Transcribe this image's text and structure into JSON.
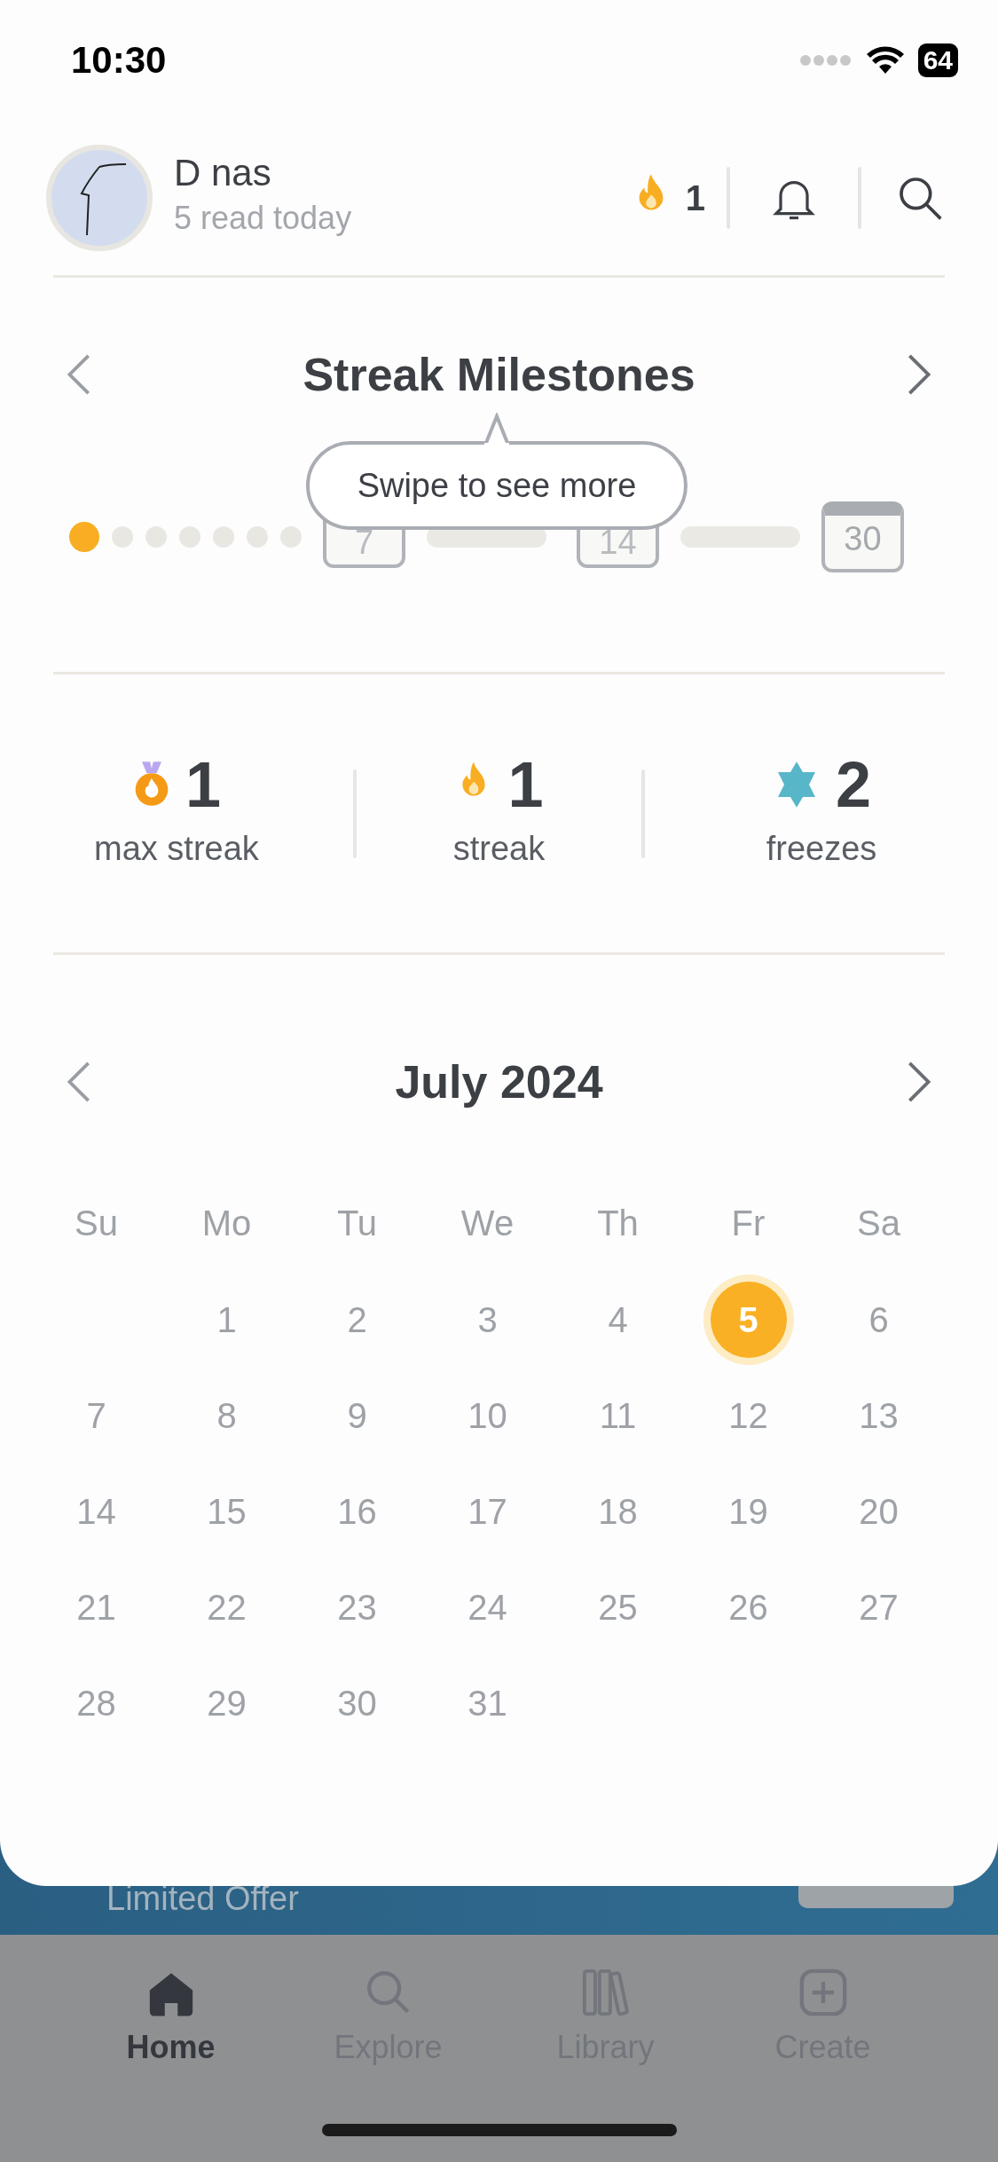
{
  "status_bar": {
    "time": "10:30",
    "battery": "64"
  },
  "header": {
    "name": "D nas",
    "subtitle": "5 read today",
    "streak": "1"
  },
  "milestones": {
    "title": "Streak Milestones",
    "tooltip": "Swipe to see more",
    "track": [
      {
        "kind": "dot",
        "filled": true
      },
      {
        "kind": "dot",
        "filled": false
      },
      {
        "kind": "dot",
        "filled": false
      },
      {
        "kind": "dot",
        "filled": false
      },
      {
        "kind": "dot",
        "filled": false
      },
      {
        "kind": "dot",
        "filled": false
      },
      {
        "kind": "dot",
        "filled": false
      },
      {
        "kind": "badge",
        "label": "7"
      },
      {
        "kind": "bar"
      },
      {
        "kind": "badge",
        "label": "14"
      },
      {
        "kind": "bar"
      },
      {
        "kind": "calendar",
        "label": "30"
      }
    ]
  },
  "stats": [
    {
      "kind": "medal",
      "value": "1",
      "label": "max streak"
    },
    {
      "kind": "flame",
      "value": "1",
      "label": "streak"
    },
    {
      "kind": "freeze",
      "value": "2",
      "label": "freezes"
    }
  ],
  "calendar": {
    "title": "July 2024",
    "weekdays": [
      "Su",
      "Mo",
      "Tu",
      "We",
      "Th",
      "Fr",
      "Sa"
    ],
    "weeks": [
      {
        "kind": "first",
        "days": [
          {
            "label": "1",
            "selected": false
          },
          {
            "label": "2",
            "selected": false
          },
          {
            "label": "3",
            "selected": false
          },
          {
            "label": "4",
            "selected": false
          },
          {
            "label": "5",
            "selected": true
          },
          {
            "label": "6",
            "selected": false
          }
        ]
      },
      {
        "kind": "rest",
        "days": [
          {
            "label": "7",
            "selected": false
          },
          {
            "label": "8",
            "selected": false
          },
          {
            "label": "9",
            "selected": false
          },
          {
            "label": "10",
            "selected": false
          },
          {
            "label": "11",
            "selected": false
          },
          {
            "label": "12",
            "selected": false
          },
          {
            "label": "13",
            "selected": false
          }
        ]
      },
      {
        "kind": "rest",
        "days": [
          {
            "label": "14",
            "selected": false
          },
          {
            "label": "15",
            "selected": false
          },
          {
            "label": "16",
            "selected": false
          },
          {
            "label": "17",
            "selected": false
          },
          {
            "label": "18",
            "selected": false
          },
          {
            "label": "19",
            "selected": false
          },
          {
            "label": "20",
            "selected": false
          }
        ]
      },
      {
        "kind": "rest",
        "days": [
          {
            "label": "21",
            "selected": false
          },
          {
            "label": "22",
            "selected": false
          },
          {
            "label": "23",
            "selected": false
          },
          {
            "label": "24",
            "selected": false
          },
          {
            "label": "25",
            "selected": false
          },
          {
            "label": "26",
            "selected": false
          },
          {
            "label": "27",
            "selected": false
          }
        ]
      },
      {
        "kind": "rest",
        "days": [
          {
            "label": "28",
            "selected": false
          },
          {
            "label": "29",
            "selected": false
          },
          {
            "label": "30",
            "selected": false
          },
          {
            "label": "31",
            "selected": false
          }
        ]
      }
    ]
  },
  "banner": {
    "title": "Limited Offer"
  },
  "tabs": [
    {
      "label": "Home",
      "selected": true,
      "kind": "home"
    },
    {
      "label": "Explore",
      "selected": false,
      "kind": "explore"
    },
    {
      "label": "Library",
      "selected": false,
      "kind": "library"
    },
    {
      "label": "Create",
      "selected": false,
      "kind": "create"
    }
  ]
}
